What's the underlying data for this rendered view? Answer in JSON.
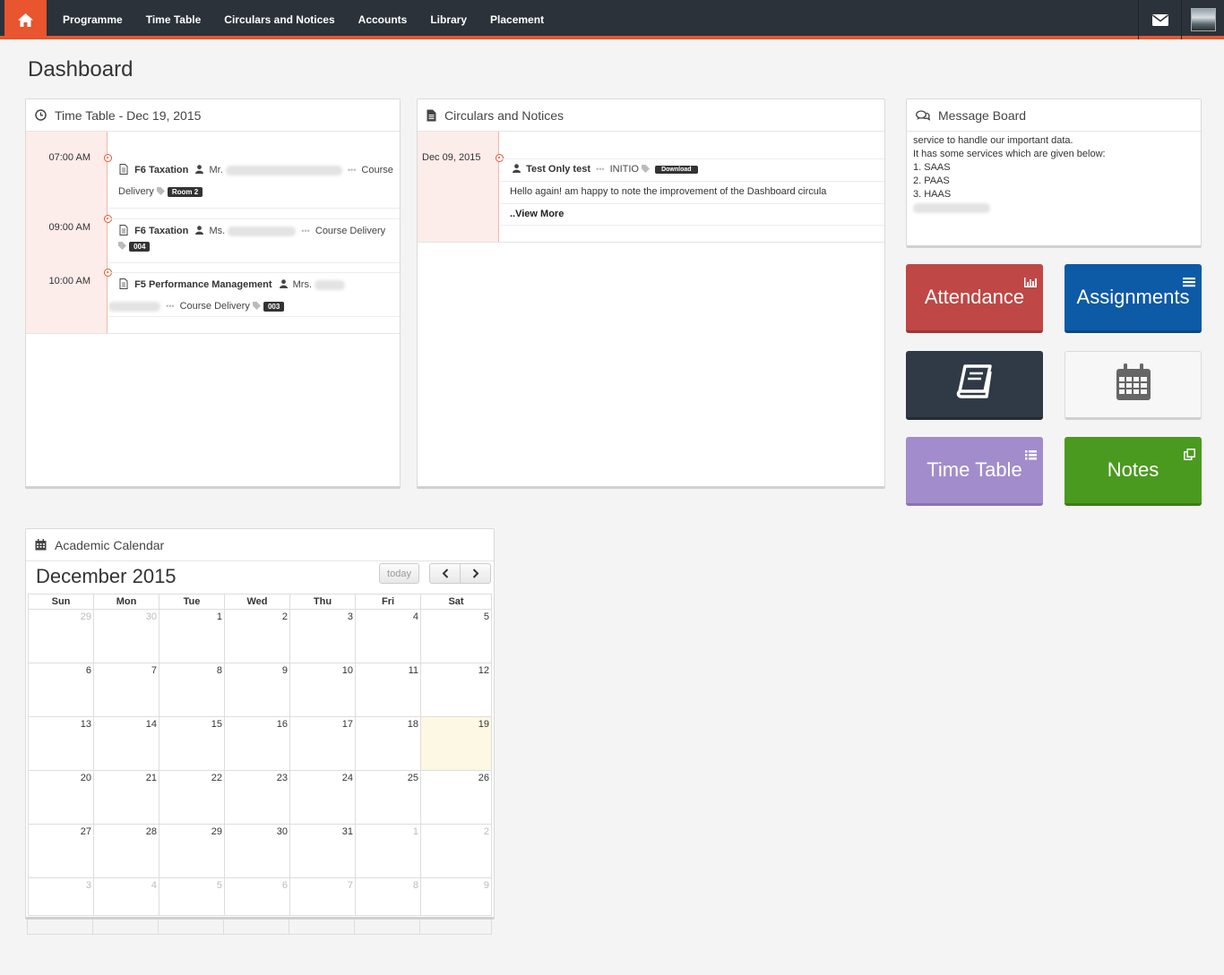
{
  "nav": {
    "items": [
      "Programme",
      "Time Table",
      "Circulars and Notices",
      "Accounts",
      "Library",
      "Placement"
    ]
  },
  "page": {
    "title": "Dashboard"
  },
  "timetable": {
    "title": "Time Table - Dec 19, 2015",
    "entries": [
      {
        "time": "07:00 AM",
        "subject": "F6 Taxation",
        "teacher_prefix": "Mr.",
        "type": "Course Delivery",
        "type_a": "Course",
        "type_b": "Delivery",
        "room": "Room 2"
      },
      {
        "time": "09:00 AM",
        "subject": "F6 Taxation",
        "teacher_prefix": "Ms.",
        "type": "Course Delivery",
        "room": "004"
      },
      {
        "time": "10:00 AM",
        "subject": "F5 Performance Management",
        "teacher_prefix": "Mrs.",
        "type": "Course Delivery",
        "room": "003"
      }
    ]
  },
  "circulars": {
    "title": "Circulars and Notices",
    "date": "Dec 09, 2015",
    "notice_title": "Test Only test",
    "author": "INITIO",
    "download_label": "Download",
    "body": "Hello again! am happy to note the improvement of the Dashboard circula",
    "view_more": "..View More"
  },
  "message_board": {
    "title": "Message Board",
    "lines": [
      "service to handle our important data.",
      "It has some services which are given below:",
      "1. SAAS",
      "2. PAAS",
      "3. HAAS"
    ]
  },
  "tiles": {
    "attendance": "Attendance",
    "assignments": "Assignments",
    "timetable": "Time Table",
    "notes": "Notes"
  },
  "calendar": {
    "panel_title": "Academic Calendar",
    "month_title": "December 2015",
    "today_label": "today",
    "days": [
      "Sun",
      "Mon",
      "Tue",
      "Wed",
      "Thu",
      "Fri",
      "Sat"
    ],
    "weeks": [
      [
        {
          "d": "29",
          "o": true
        },
        {
          "d": "30",
          "o": true
        },
        {
          "d": "1"
        },
        {
          "d": "2"
        },
        {
          "d": "3"
        },
        {
          "d": "4"
        },
        {
          "d": "5"
        }
      ],
      [
        {
          "d": "6"
        },
        {
          "d": "7"
        },
        {
          "d": "8"
        },
        {
          "d": "9"
        },
        {
          "d": "10"
        },
        {
          "d": "11"
        },
        {
          "d": "12"
        }
      ],
      [
        {
          "d": "13"
        },
        {
          "d": "14"
        },
        {
          "d": "15"
        },
        {
          "d": "16"
        },
        {
          "d": "17"
        },
        {
          "d": "18"
        },
        {
          "d": "19",
          "t": true
        }
      ],
      [
        {
          "d": "20"
        },
        {
          "d": "21"
        },
        {
          "d": "22"
        },
        {
          "d": "23"
        },
        {
          "d": "24"
        },
        {
          "d": "25"
        },
        {
          "d": "26"
        }
      ],
      [
        {
          "d": "27"
        },
        {
          "d": "28"
        },
        {
          "d": "29"
        },
        {
          "d": "30"
        },
        {
          "d": "31"
        },
        {
          "d": "1",
          "o": true
        },
        {
          "d": "2",
          "o": true
        }
      ],
      [
        {
          "d": "3",
          "o": true
        },
        {
          "d": "4",
          "o": true
        },
        {
          "d": "5",
          "o": true
        },
        {
          "d": "6",
          "o": true
        },
        {
          "d": "7",
          "o": true
        },
        {
          "d": "8",
          "o": true
        },
        {
          "d": "9",
          "o": true
        }
      ]
    ]
  },
  "colors": {
    "accent": "#e8552f",
    "nav_bg": "#2b3239",
    "attendance": "#bf4745",
    "assignments": "#0d5aa7",
    "library": "#2f3a46",
    "calendar_tile": "#f7f7f7",
    "timetable_tile": "#a28ccb",
    "notes": "#4a9a1f",
    "today_cell": "#fcf8e3"
  }
}
